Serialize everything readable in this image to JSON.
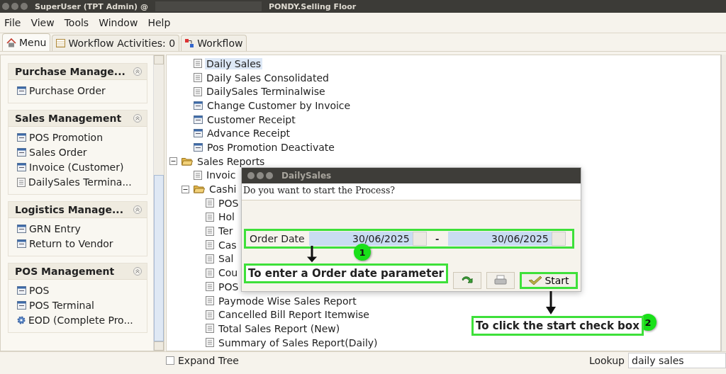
{
  "window": {
    "title": "SuperUser (TPT Admin) @",
    "subtitle": "PONDY.Selling Floor"
  },
  "menu": [
    "File",
    "View",
    "Tools",
    "Window",
    "Help"
  ],
  "tabs": [
    {
      "label": "Menu",
      "kind": "home",
      "selected": true
    },
    {
      "label": "Workflow Activities: 0",
      "kind": "list",
      "selected": false
    },
    {
      "label": "Workflow",
      "kind": "flow",
      "selected": false
    }
  ],
  "sidebar": {
    "sections": [
      {
        "title": "Purchase Manage...",
        "items": [
          {
            "label": "Purchase Order",
            "kind": "form"
          }
        ]
      },
      {
        "title": "Sales Management",
        "items": [
          {
            "label": "POS Promotion",
            "kind": "form"
          },
          {
            "label": "Sales Order",
            "kind": "form"
          },
          {
            "label": "Invoice (Customer)",
            "kind": "form"
          },
          {
            "label": "DailySales Termina...",
            "kind": "report"
          }
        ]
      },
      {
        "title": "Logistics Manage...",
        "items": [
          {
            "label": "GRN Entry",
            "kind": "form"
          },
          {
            "label": "Return to Vendor",
            "kind": "form"
          }
        ]
      },
      {
        "title": "POS Management",
        "items": [
          {
            "label": "POS",
            "kind": "form"
          },
          {
            "label": "POS Terminal",
            "kind": "form"
          },
          {
            "label": "EOD (Complete Pro...",
            "kind": "process"
          }
        ]
      }
    ]
  },
  "tree": [
    {
      "kind": "offscreen",
      "children": [
        {
          "label": "Daily Sales",
          "kind": "report",
          "selected": true
        },
        {
          "label": "Daily Sales Consolidated",
          "kind": "report",
          "selected": false
        },
        {
          "label": "DailySales Terminalwise",
          "kind": "report",
          "selected": false
        },
        {
          "label": "Change Customer by Invoice",
          "kind": "form",
          "selected": false
        },
        {
          "label": "Customer Receipt",
          "kind": "form",
          "selected": false
        },
        {
          "label": "Advance Receipt",
          "kind": "form",
          "selected": false
        },
        {
          "label": "Pos Promotion Deactivate",
          "kind": "form",
          "selected": false
        }
      ]
    },
    {
      "label": "Sales Reports",
      "kind": "folder",
      "expanded": true,
      "selected": false,
      "children": [
        {
          "label": "Invoic",
          "kind": "report",
          "selected": false
        },
        {
          "label": "Cashi",
          "kind": "folder",
          "expanded": true,
          "selected": false,
          "children": [
            {
              "label": "POS",
              "kind": "report",
              "selected": false
            },
            {
              "label": "Hol",
              "kind": "report",
              "selected": false
            },
            {
              "label": "Ter",
              "kind": "report",
              "selected": false
            },
            {
              "label": "Cas",
              "kind": "report",
              "selected": false
            },
            {
              "label": "Sal",
              "kind": "report",
              "selected": false
            },
            {
              "label": "Cou",
              "kind": "report",
              "selected": false
            },
            {
              "label": "POS",
              "kind": "report",
              "selected": false
            },
            {
              "label": "Paymode Wise Sales Report",
              "kind": "report",
              "selected": false
            },
            {
              "label": "Cancelled Bill Report Itemwise",
              "kind": "report",
              "selected": false
            },
            {
              "label": "Total Sales Report (New)",
              "kind": "report",
              "selected": false
            },
            {
              "label": "Summary of Sales Report(Daily)",
              "kind": "report",
              "selected": false
            }
          ]
        }
      ]
    }
  ],
  "dialog": {
    "title": "DailySales",
    "question": "Do you want to start the Process?",
    "field_label": "Order Date",
    "date_from": "30/06/2025",
    "separator": "-",
    "date_to": "30/06/2025",
    "buttons": [
      {
        "kind": "refresh"
      },
      {
        "kind": "print"
      },
      {
        "kind": "start",
        "label": "Start"
      }
    ]
  },
  "annotations": [
    {
      "number": "1",
      "text": "To enter a Order date parameter"
    },
    {
      "number": "2",
      "text": "To click the start check box"
    }
  ],
  "bottom": {
    "expand_tree": {
      "label": "Expand Tree",
      "checked": false
    },
    "lookup_label": "Lookup",
    "lookup_value": "daily sales"
  }
}
